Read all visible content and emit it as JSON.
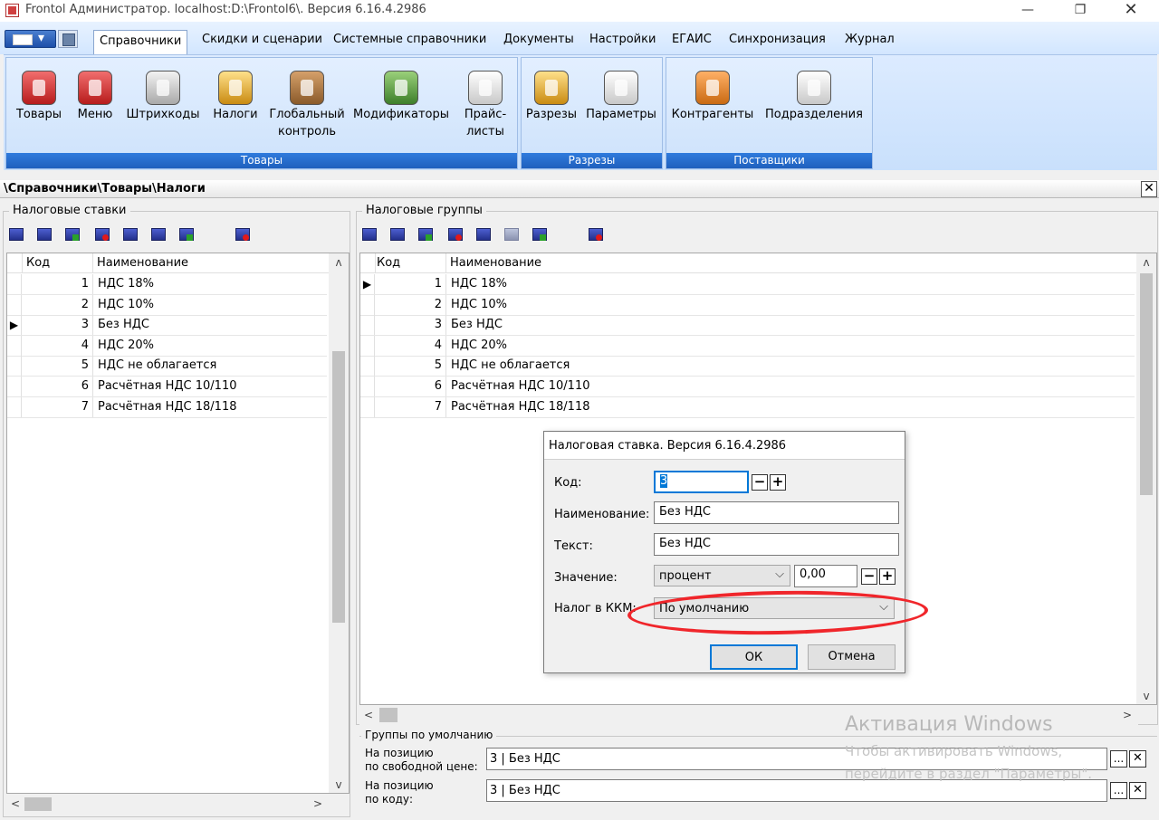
{
  "window": {
    "title": "Frontol Администратор. localhost:D:\\Frontol6\\. Версия 6.16.4.2986",
    "minimize_glyph": "—",
    "maximize_glyph": "❐",
    "close_glyph": "✕"
  },
  "ribbon": {
    "tabs": [
      "Справочники",
      "Скидки и сценарии",
      "Системные справочники",
      "Документы",
      "Настройки",
      "ЕГАИС",
      "Синхронизация",
      "Журнал"
    ],
    "active_tab": "Справочники",
    "groups": [
      {
        "caption": "Товары",
        "buttons": [
          {
            "label": "Товары",
            "icon": "bottle-icon"
          },
          {
            "label": "Меню",
            "icon": "menu-book-icon"
          },
          {
            "label": "Штрихкоды",
            "icon": "barcode-icon"
          },
          {
            "label": "Налоги",
            "icon": "coins-icon"
          },
          {
            "label": "Глобальный контроль",
            "icon": "box-tools-icon"
          },
          {
            "label": "Модификаторы",
            "icon": "wine-icon"
          },
          {
            "label": "Прайс-листы",
            "icon": "price-list-icon"
          }
        ]
      },
      {
        "caption": "Разрезы",
        "buttons": [
          {
            "label": "Разрезы",
            "icon": "slices-icon"
          },
          {
            "label": "Параметры",
            "icon": "tools-icon"
          }
        ]
      },
      {
        "caption": "Поставщики",
        "buttons": [
          {
            "label": "Контрагенты",
            "icon": "worker-icon"
          },
          {
            "label": "Подразделения",
            "icon": "store-icon"
          }
        ]
      }
    ]
  },
  "breadcrumb": {
    "path": "\\Справочники\\Товары\\Налоги",
    "close_glyph": "✕"
  },
  "tax_rates": {
    "title": "Налоговые ставки",
    "columns": {
      "code": "Код",
      "name": "Наименование"
    },
    "current_row": 3,
    "rows": [
      {
        "code": "1",
        "name": "НДС 18%"
      },
      {
        "code": "2",
        "name": "НДС 10%"
      },
      {
        "code": "3",
        "name": "Без НДС"
      },
      {
        "code": "4",
        "name": "НДС 20%"
      },
      {
        "code": "5",
        "name": "НДС не облагается"
      },
      {
        "code": "6",
        "name": "Расчётная НДС 10/110"
      },
      {
        "code": "7",
        "name": "Расчётная НДС 18/118"
      }
    ]
  },
  "tax_groups": {
    "title": "Налоговые группы",
    "columns": {
      "code": "Код",
      "name": "Наименование"
    },
    "current_row": 1,
    "rows": [
      {
        "code": "1",
        "name": "НДС 18%"
      },
      {
        "code": "2",
        "name": "НДС 10%"
      },
      {
        "code": "3",
        "name": "Без НДС"
      },
      {
        "code": "4",
        "name": "НДС 20%"
      },
      {
        "code": "5",
        "name": "НДС не облагается"
      },
      {
        "code": "6",
        "name": "Расчётная НДС 10/110"
      },
      {
        "code": "7",
        "name": "Расчётная НДС 18/118"
      }
    ]
  },
  "defaults": {
    "title": "Группы по умолчанию",
    "free_price_label_1": "На позицию",
    "free_price_label_2": "по свободной цене:",
    "free_price_value": "3 | Без НДС",
    "by_code_label_1": "На позицию",
    "by_code_label_2": "по коду:",
    "by_code_value": "3 | Без НДС",
    "ellipsis_glyph": "...",
    "clear_glyph": "✕"
  },
  "dialog": {
    "title": "Налоговая ставка. Версия 6.16.4.2986",
    "code_label": "Код:",
    "code_value": "3",
    "name_label": "Наименование:",
    "name_value": "Без НДС",
    "text_label": "Текст:",
    "text_value": "Без НДС",
    "value_label": "Значение:",
    "value_type": "процент",
    "value_amount": "0,00",
    "kkm_label": "Налог в ККМ:",
    "kkm_value": "По умолчанию",
    "ok_label": "ОК",
    "cancel_label": "Отмена",
    "spin_minus": "−",
    "spin_plus": "+"
  },
  "watermark": {
    "title": "Активация Windows",
    "line1": "Чтобы активировать Windows,",
    "line2": "перейдите в раздел \"Параметры\"."
  },
  "colors": {
    "accent": "#1f60bd",
    "highlight": "#f0262b"
  }
}
